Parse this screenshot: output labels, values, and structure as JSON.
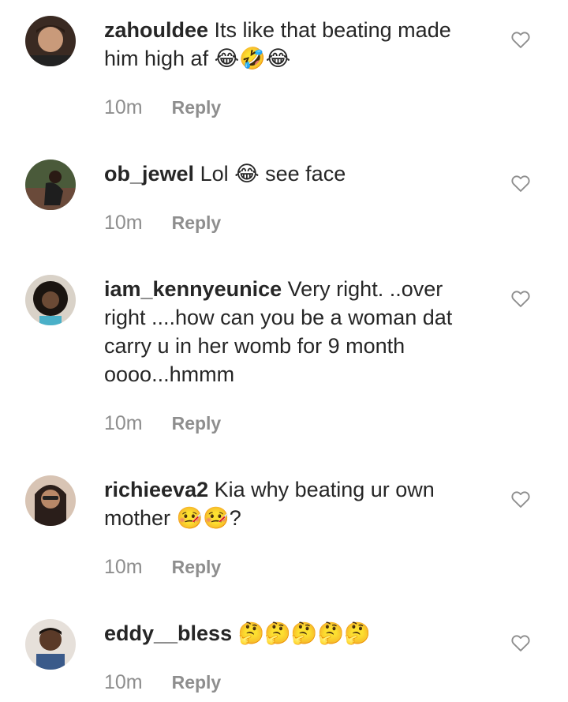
{
  "comments": [
    {
      "username": "zahouldee",
      "text": "Its like that beating made him high af 😂🤣😂",
      "time": "10m",
      "reply": "Reply"
    },
    {
      "username": "ob_jewel",
      "text": "Lol 😂 see face",
      "time": "10m",
      "reply": "Reply"
    },
    {
      "username": "iam_kennyeunice",
      "text": "Very right. ..over right ....how can you be a woman dat carry u in her womb for 9 month oooo...hmmm",
      "time": "10m",
      "reply": "Reply"
    },
    {
      "username": "richieeva2",
      "text": "Kia why beating ur own mother 🤒🤒?",
      "time": "10m",
      "reply": "Reply"
    },
    {
      "username": "eddy__bless",
      "text": "🤔🤔🤔🤔🤔",
      "time": "10m",
      "reply": "Reply"
    }
  ],
  "icons": {
    "like": "heart-outline-icon"
  },
  "colors": {
    "text": "#262626",
    "muted": "#8e8e8e"
  }
}
